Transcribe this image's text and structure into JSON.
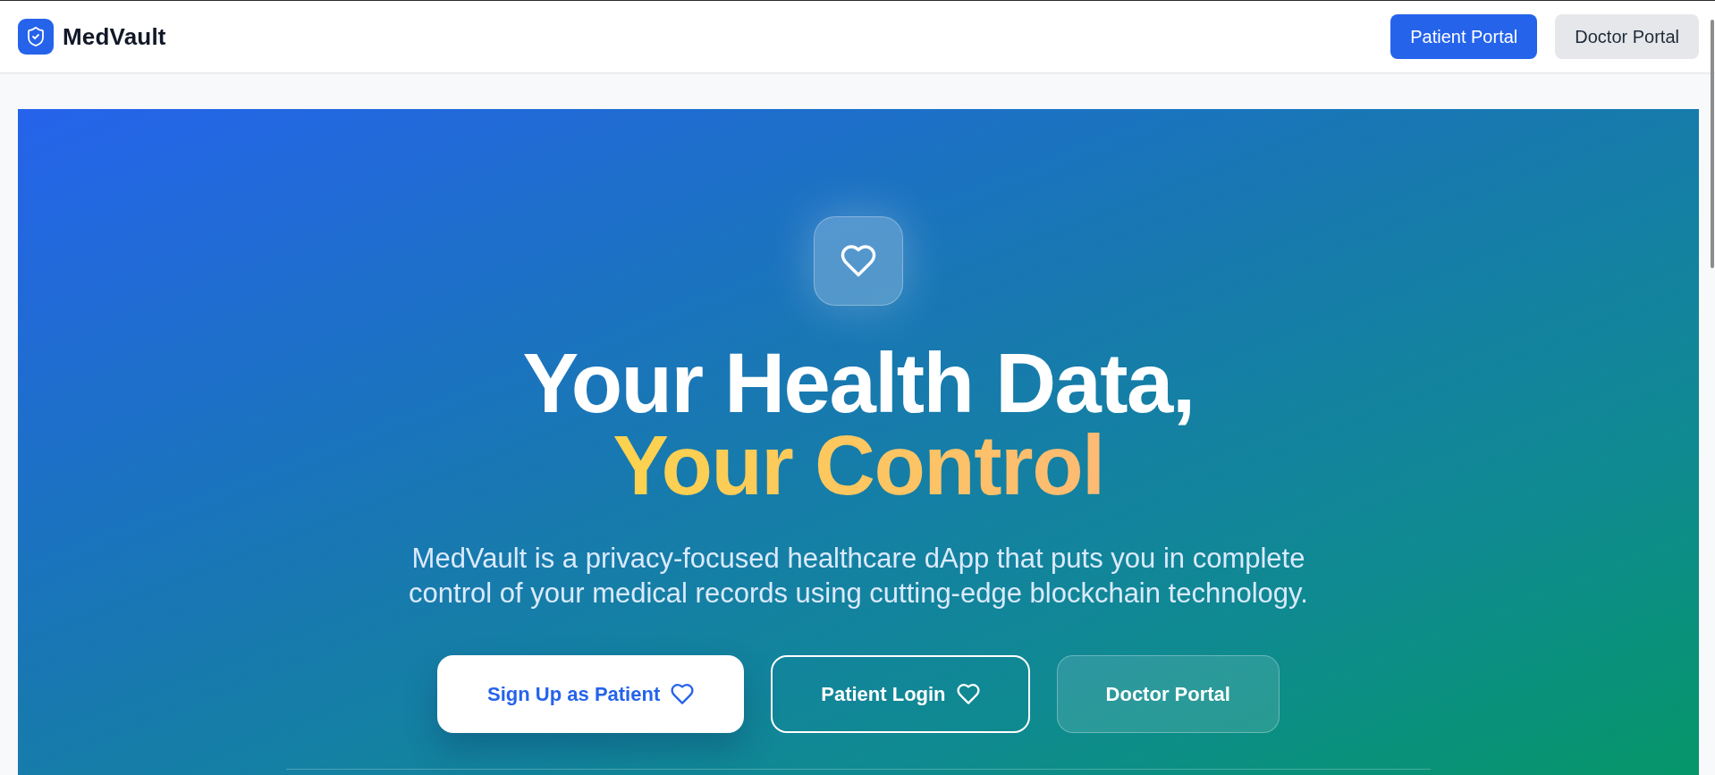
{
  "header": {
    "brand": "MedVault",
    "portal_tabs": [
      {
        "label": "Patient Portal",
        "selected": true
      },
      {
        "label": "Doctor Portal",
        "selected": false
      }
    ]
  },
  "hero": {
    "title": "Your Health Data,",
    "title_highlight": "Your Control",
    "description": "MedVault is a privacy-focused healthcare dApp that puts you in complete control of your medical records using cutting-edge blockchain technology.",
    "actions": [
      {
        "label": "Sign Up as Patient",
        "kind": "solid",
        "trailing_icon": true
      },
      {
        "label": "Patient Login",
        "kind": "outline",
        "trailing_icon": true
      },
      {
        "label": "Doctor Portal",
        "kind": "glass",
        "trailing_icon": false
      }
    ]
  }
}
